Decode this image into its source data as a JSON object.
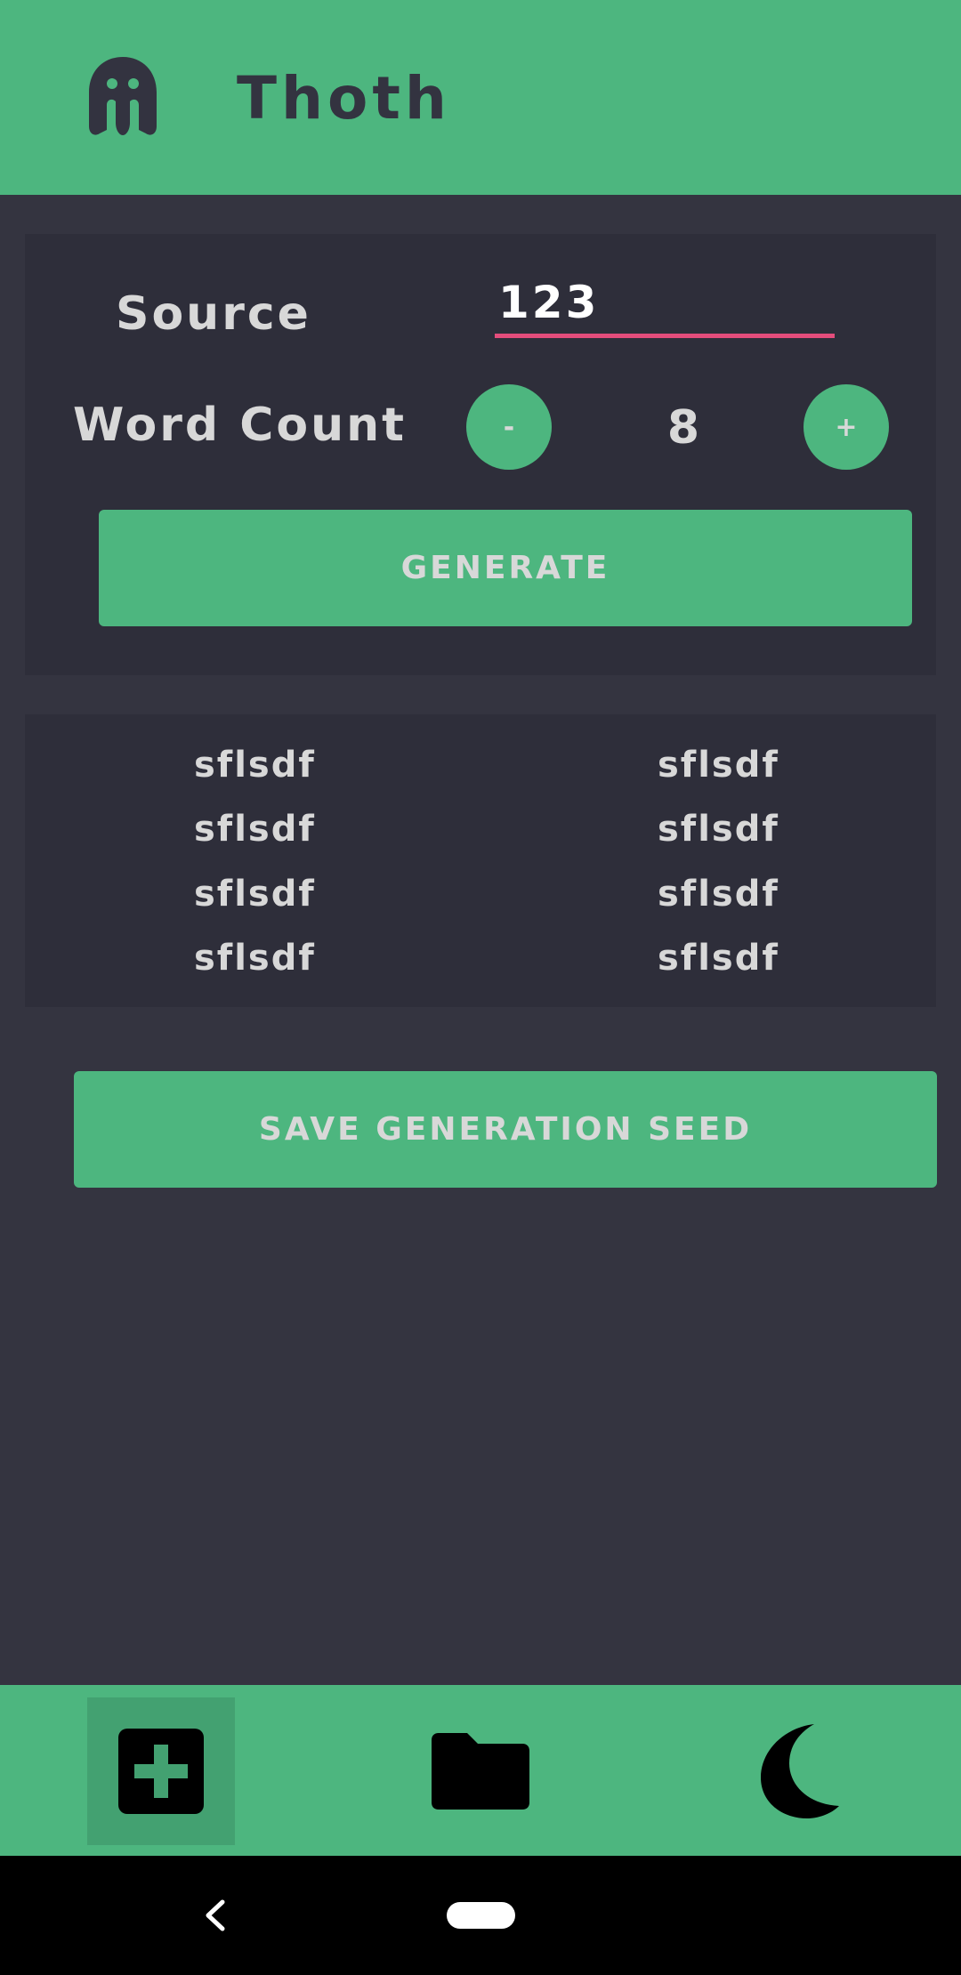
{
  "header": {
    "app_title": "Thoth",
    "logo_icon": "ghost-logo-icon"
  },
  "controls": {
    "source_label": "Source",
    "source_value": "123",
    "word_count_label": "Word Count",
    "minus_label": "-",
    "word_count_value": "8",
    "plus_label": "+",
    "generate_label": "GENERATE"
  },
  "words": {
    "left_column": [
      "sflsdf",
      "sflsdf",
      "sflsdf",
      "sflsdf"
    ],
    "right_column": [
      "sflsdf",
      "sflsdf",
      "sflsdf",
      "sflsdf"
    ]
  },
  "save_label": "SAVE GENERATION SEED",
  "bottom_nav": {
    "items": [
      {
        "icon": "add-box-icon",
        "active": true
      },
      {
        "icon": "folder-icon",
        "active": false
      },
      {
        "icon": "moon-icon",
        "active": false
      }
    ]
  },
  "colors": {
    "accent": "#4db67f",
    "background": "#343440",
    "card": "#2e2e3a",
    "input_underline": "#e44d7c",
    "text": "#d8d8d8"
  }
}
